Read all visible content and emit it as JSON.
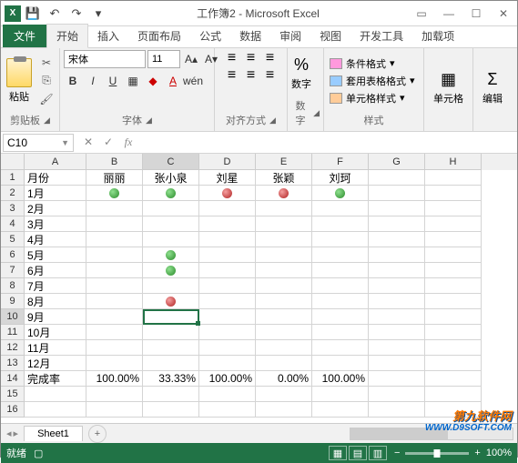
{
  "title": "工作簿2 - Microsoft Excel",
  "tabs": {
    "file": "文件",
    "home": "开始",
    "insert": "插入",
    "layout": "页面布局",
    "formulas": "公式",
    "data": "数据",
    "review": "审阅",
    "view": "视图",
    "dev": "开发工具",
    "addins": "加载项"
  },
  "ribbon": {
    "clipboard": {
      "paste": "粘贴",
      "label": "剪贴板"
    },
    "font": {
      "name": "宋体",
      "size": "11",
      "label": "字体"
    },
    "align": {
      "label": "对齐方式"
    },
    "number": {
      "btn": "数字",
      "label": "数字"
    },
    "styles": {
      "cond": "条件格式",
      "table": "套用表格格式",
      "cell": "单元格样式",
      "label": "样式"
    },
    "cells": {
      "btn": "单元格"
    },
    "editing": {
      "btn": "编辑"
    }
  },
  "nameBox": "C10",
  "formula": "",
  "columns": [
    "A",
    "B",
    "C",
    "D",
    "E",
    "F",
    "G",
    "H"
  ],
  "rows": [
    "1",
    "2",
    "3",
    "4",
    "5",
    "6",
    "7",
    "8",
    "9",
    "10",
    "11",
    "12",
    "13",
    "14",
    "15",
    "16"
  ],
  "headerRow": {
    "A": "月份",
    "B": "丽丽",
    "C": "张小泉",
    "D": "刘星",
    "E": "张颖",
    "F": "刘珂"
  },
  "months": {
    "r2": "1月",
    "r3": "2月",
    "r4": "3月",
    "r5": "4月",
    "r6": "5月",
    "r7": "6月",
    "r8": "7月",
    "r9": "8月",
    "r10": "9月",
    "r11": "10月",
    "r12": "11月",
    "r13": "12月"
  },
  "summary": {
    "label": "完成率",
    "B": "100.00%",
    "C": "33.33%",
    "D": "100.00%",
    "E": "0.00%",
    "F": "100.00%"
  },
  "dots": {
    "r2": {
      "B": "green",
      "C": "green",
      "D": "red",
      "E": "red",
      "F": "green"
    },
    "r6": {
      "C": "green"
    },
    "r7": {
      "C": "green"
    },
    "r9": {
      "C": "red"
    }
  },
  "sheet": {
    "name": "Sheet1"
  },
  "status": {
    "ready": "就绪",
    "zoom": "100%"
  },
  "watermark": {
    "line1": "第九软件网",
    "line2": "WWW.D9SOFT.COM"
  }
}
